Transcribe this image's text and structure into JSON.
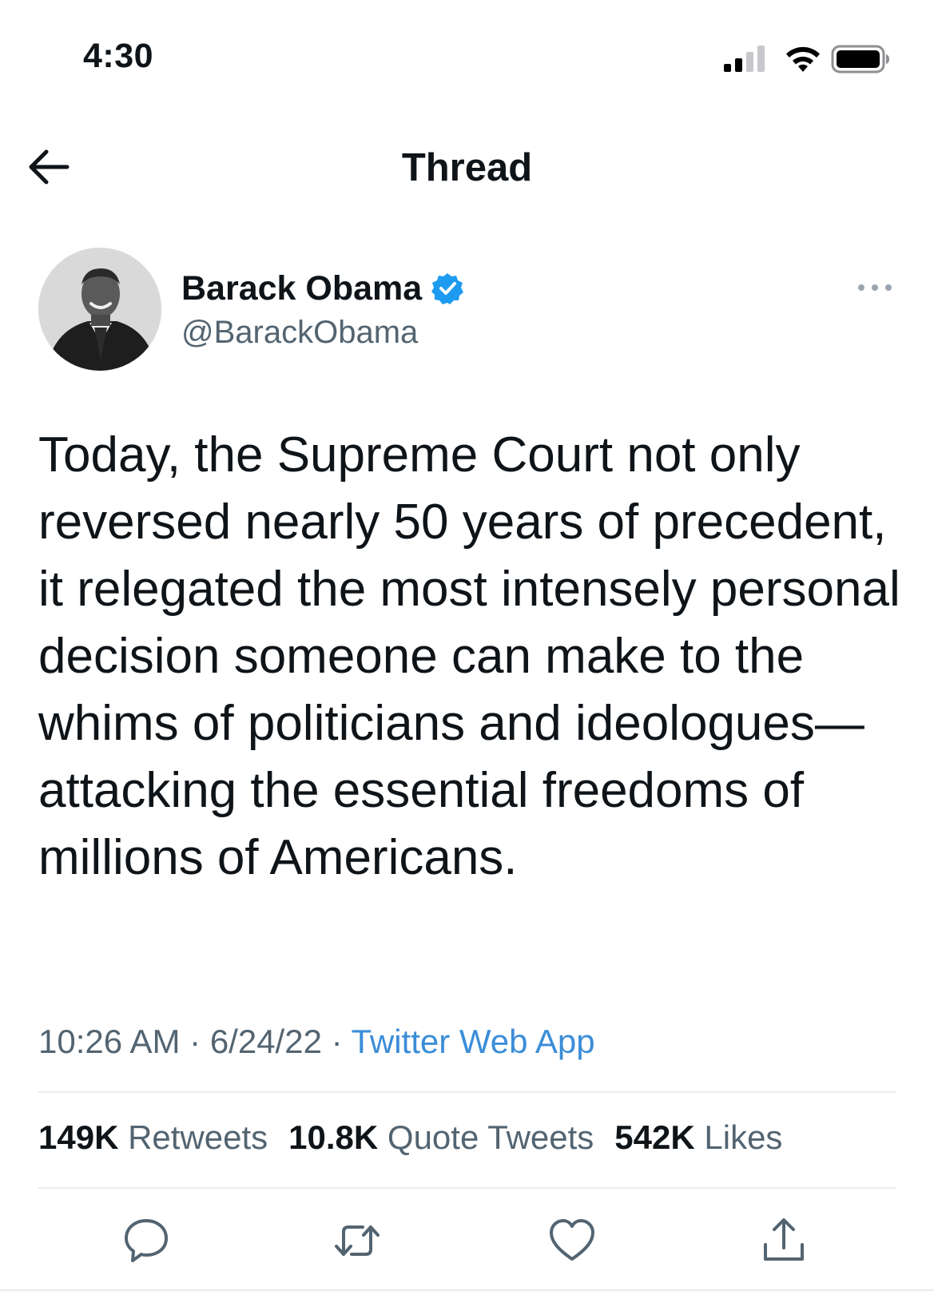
{
  "status_bar": {
    "time": "4:30",
    "signal_icon": "cellular-signal-icon",
    "wifi_icon": "wifi-icon",
    "battery_icon": "battery-icon"
  },
  "header": {
    "back_icon": "arrow-left-icon",
    "title": "Thread"
  },
  "tweet": {
    "author": {
      "name": "Barack Obama",
      "handle": "@BarackObama",
      "verified": true,
      "verified_color": "#1d9bf0"
    },
    "more_icon": "more-horizontal-icon",
    "text": "Today, the Supreme Court not only reversed nearly 50 years of precedent, it relegated the most intensely personal decision someone can make to the whims of politicians and ideologues—attacking the essential freedoms of millions of Americans.",
    "time": "10:26 AM",
    "date": "6/24/22",
    "separator": "·",
    "source": "Twitter Web App",
    "source_color": "#3b8dd8"
  },
  "stats": {
    "retweets_count": "149K",
    "retweets_label": "Retweets",
    "quotes_count": "10.8K",
    "quotes_label": "Quote Tweets",
    "likes_count": "542K",
    "likes_label": "Likes"
  },
  "actions": {
    "reply_icon": "reply-icon",
    "retweet_icon": "retweet-icon",
    "like_icon": "heart-icon",
    "share_icon": "share-icon"
  },
  "colors": {
    "text_primary": "#0f1419",
    "text_secondary": "#536471",
    "divider": "#e6ecf0"
  }
}
